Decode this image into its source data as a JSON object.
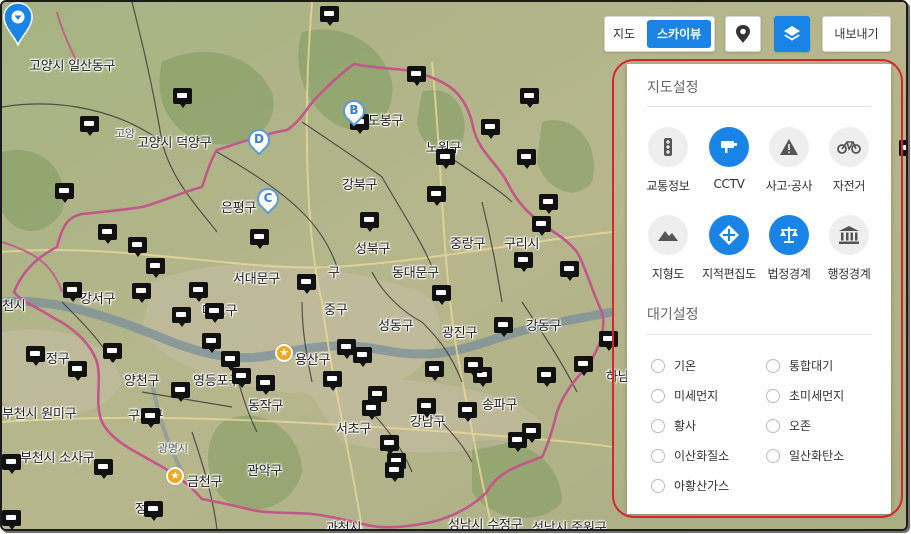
{
  "map": {
    "labels": [
      {
        "id": "goyang-ilsandong",
        "text": "고양시 일산동구"
      },
      {
        "id": "goyang-deogyang",
        "text": "고양시 덕양구"
      },
      {
        "id": "goyang-faint",
        "text": "고양"
      },
      {
        "id": "dobong",
        "text": "도봉구"
      },
      {
        "id": "nowon",
        "text": "노원구"
      },
      {
        "id": "gangbuk",
        "text": "강북구"
      },
      {
        "id": "eunpyeong",
        "text": "은평구"
      },
      {
        "id": "seongbuk",
        "text": "성북구"
      },
      {
        "id": "jungnang",
        "text": "중랑구"
      },
      {
        "id": "guri",
        "text": "구리시"
      },
      {
        "id": "seodaemun",
        "text": "서대문구"
      },
      {
        "id": "jongno",
        "text": "구"
      },
      {
        "id": "dongdaemun",
        "text": "동대문구"
      },
      {
        "id": "gangseo",
        "text": "강서구"
      },
      {
        "id": "mapo",
        "text": "마포구"
      },
      {
        "id": "junggu",
        "text": "중구"
      },
      {
        "id": "seongdong",
        "text": "성동구"
      },
      {
        "id": "gwangjin",
        "text": "광진구"
      },
      {
        "id": "gangdong",
        "text": "강동구"
      },
      {
        "id": "cheon",
        "text": "천시"
      },
      {
        "id": "yangcheon",
        "text": "양천구"
      },
      {
        "id": "yeongdeungpo",
        "text": "영등포구"
      },
      {
        "id": "yongsan",
        "text": "용산구"
      },
      {
        "id": "hanam",
        "text": "하남"
      },
      {
        "id": "bucheon-wonmi",
        "text": "부천시 원미구"
      },
      {
        "id": "guro",
        "text": "구로구"
      },
      {
        "id": "dongjak",
        "text": "동작구"
      },
      {
        "id": "seocho",
        "text": "서초구"
      },
      {
        "id": "gangnam",
        "text": "강남구"
      },
      {
        "id": "songpa",
        "text": "송파구"
      },
      {
        "id": "bucheon-sosa",
        "text": "부천시 소사구"
      },
      {
        "id": "geumcheon",
        "text": "금천구"
      },
      {
        "id": "gwanak",
        "text": "관악구"
      },
      {
        "id": "gwangmyeong",
        "text": "광명시"
      },
      {
        "id": "gwacheon",
        "text": "과천시"
      },
      {
        "id": "seongnam-sujeong",
        "text": "성남시 수정구"
      },
      {
        "id": "seongnam-jungwon",
        "text": "성남시 중원구"
      },
      {
        "id": "seongnam-west",
        "text": "정구"
      },
      {
        "id": "faint-gangseo",
        "text": "정시"
      }
    ],
    "waypoints": [
      {
        "id": "b",
        "letter": "B"
      },
      {
        "id": "d",
        "letter": "D"
      },
      {
        "id": "c",
        "letter": "C"
      }
    ],
    "cctv_count": 60
  },
  "toolbar": {
    "map_type_options": [
      "지도",
      "스카이뷰"
    ],
    "active_map_type": "스카이뷰",
    "location_button_icon": "location-pin-icon",
    "layers_button_icon": "layers-icon",
    "export_label": "내보내기"
  },
  "panel": {
    "map_settings_title": "지도설정",
    "layers": [
      {
        "id": "traffic",
        "label": "교통정보",
        "icon": "traffic-light-icon",
        "active": false
      },
      {
        "id": "cctv",
        "label": "CCTV",
        "icon": "cctv-icon",
        "active": true
      },
      {
        "id": "accident",
        "label": "사고·공사",
        "icon": "warning-icon",
        "active": false
      },
      {
        "id": "bicycle",
        "label": "자전거",
        "icon": "bicycle-icon",
        "active": false
      },
      {
        "id": "terrain",
        "label": "지형도",
        "icon": "mountain-icon",
        "active": false
      },
      {
        "id": "cadastral",
        "label": "지적편집도",
        "icon": "cadastral-icon",
        "active": true
      },
      {
        "id": "legal",
        "label": "법정경계",
        "icon": "scales-icon",
        "active": true
      },
      {
        "id": "admin",
        "label": "행정경계",
        "icon": "government-building-icon",
        "active": false
      }
    ],
    "air_settings_title": "대기설정",
    "air_options": [
      {
        "id": "temperature",
        "label": "기온"
      },
      {
        "id": "integrated-air",
        "label": "통합대기"
      },
      {
        "id": "fine-dust",
        "label": "미세먼지"
      },
      {
        "id": "ultrafine-dust",
        "label": "초미세먼지"
      },
      {
        "id": "yellow-dust",
        "label": "황사"
      },
      {
        "id": "ozone",
        "label": "오존"
      },
      {
        "id": "no2",
        "label": "이산화질소"
      },
      {
        "id": "co",
        "label": "일산화탄소"
      },
      {
        "id": "so2",
        "label": "아황산가스"
      }
    ]
  }
}
